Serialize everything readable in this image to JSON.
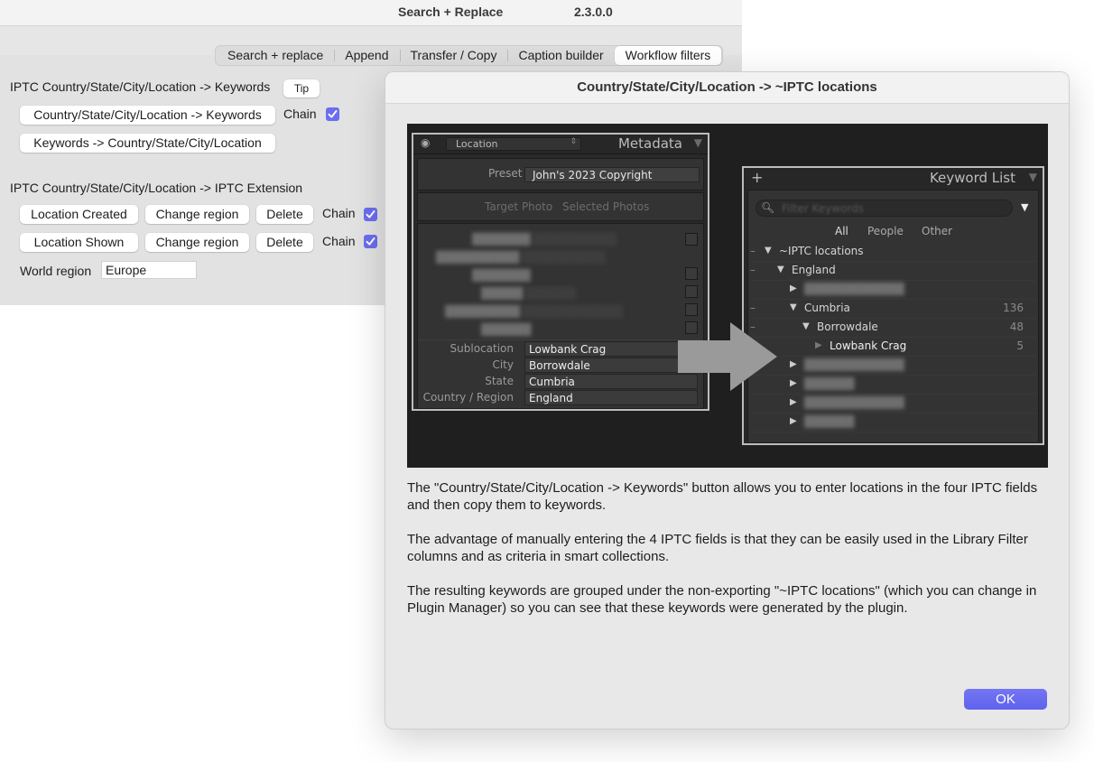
{
  "titlebar": {
    "title": "Search + Replace",
    "version": "2.3.0.0"
  },
  "tabs": [
    {
      "label": "Search + replace",
      "active": false
    },
    {
      "label": "Append",
      "active": false
    },
    {
      "label": "Transfer / Copy",
      "active": false
    },
    {
      "label": "Caption builder",
      "active": false
    },
    {
      "label": "Workflow filters",
      "active": true
    }
  ],
  "section1": {
    "heading": "IPTC Country/State/City/Location -> Keywords",
    "tip_label": "Tip",
    "to_keywords_label": "Country/State/City/Location -> Keywords",
    "chain_label": "Chain",
    "chain_checked": true,
    "from_keywords_label": "Keywords -> Country/State/City/Location"
  },
  "section2": {
    "heading": "IPTC Country/State/City/Location -> IPTC Extension",
    "rows": [
      {
        "label": "Location Created",
        "change_label": "Change region",
        "delete_label": "Delete",
        "chain_label": "Chain",
        "chain_checked": true
      },
      {
        "label": "Location Shown",
        "change_label": "Change region",
        "delete_label": "Delete",
        "chain_label": "Chain",
        "chain_checked": true
      }
    ],
    "world_region_label": "World region",
    "world_region_value": "Europe"
  },
  "dialog": {
    "title": "Country/State/City/Location -> ~IPTC locations",
    "paragraphs": [
      "The \"Country/State/City/Location -> Keywords\" button allows you to enter locations in the four IPTC fields and then copy them to keywords.",
      "The advantage of manually entering the 4 IPTC fields is that they can be easily used in the Library Filter columns and as criteria in smart collections.",
      "The resulting keywords are grouped under the non-exporting \"~IPTC locations\" (which you can change in Plugin Manager) so you can see that these keywords were generated by the plugin."
    ],
    "ok_label": "OK",
    "screenshot": {
      "metadata_panel": {
        "preset_dropdown": "Location",
        "title": "Metadata",
        "preset_label": "Preset",
        "preset_value": "John's 2023 Copyright",
        "target_photo": "Target Photo",
        "selected_photos": "Selected Photos",
        "fields": [
          {
            "label": "Sublocation",
            "value": "Lowbank Crag"
          },
          {
            "label": "City",
            "value": "Borrowdale"
          },
          {
            "label": "State",
            "value": "Cumbria"
          },
          {
            "label": "Country / Region",
            "value": "England"
          }
        ]
      },
      "keyword_panel": {
        "title": "Keyword List",
        "filter_placeholder": "Filter Keywords",
        "filters": [
          "All",
          "People",
          "Other"
        ],
        "tree": [
          {
            "name": "~IPTC locations",
            "count": ""
          },
          {
            "name": "England",
            "count": ""
          },
          {
            "name": "Cumbria",
            "count": "136"
          },
          {
            "name": "Borrowdale",
            "count": "48"
          },
          {
            "name": "Lowbank Crag",
            "count": "5"
          }
        ]
      }
    }
  },
  "colors": {
    "accent": "#6b6ef0",
    "ok_button": "#6467ee"
  }
}
